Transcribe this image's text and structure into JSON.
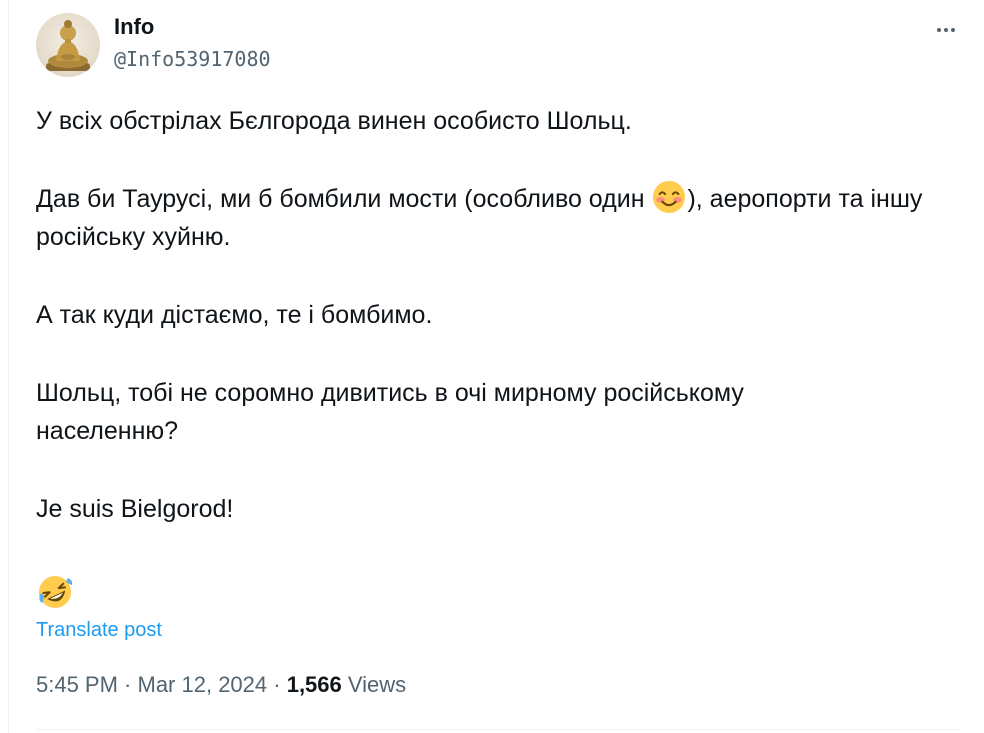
{
  "author": {
    "name": "Info",
    "handle": "@Info53917080",
    "avatar_icon": "buddha-statue-avatar"
  },
  "more_icon": "more-horizontal-icon",
  "tweet": {
    "p1": "У всіх обстрілах Бєлгорода винен особисто Шольц.",
    "p2_before": "Дав би Таурусі, ми б бомбили мости (особливо один ",
    "p2_emoji": "smiling-face-emoji",
    "p2_after": "), аеропорти та іншу російську хуйню.",
    "p3": "А так куди дістаємо, те і бомбимо.",
    "p4": "Шольц, тобі не соромно дивитись в очі мирному російському населенню?",
    "p5": "Je suis Bielgorod!",
    "trailing_emoji": "rolling-on-floor-laughing-emoji"
  },
  "translate_label": "Translate post",
  "meta": {
    "time": "5:45 PM",
    "sep1": " · ",
    "date": "Mar 12, 2024",
    "sep2": " · ",
    "views_count": "1,566",
    "views_label": " Views"
  },
  "colors": {
    "text": "#0f1419",
    "secondary": "#536471",
    "link": "#1d9bf0",
    "divider": "#eff3f4"
  }
}
